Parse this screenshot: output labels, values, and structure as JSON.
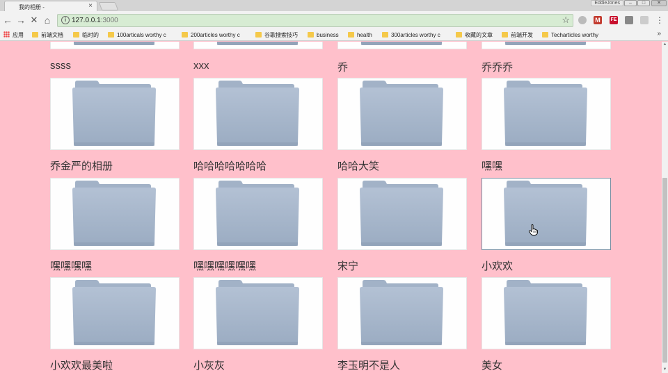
{
  "browser": {
    "tab_title": "我的相册 -",
    "tab_close": "×",
    "user_name": "EddieJones",
    "url_host": "127.0.0.1",
    "url_port": ":3000",
    "info_icon": "i",
    "star_icon": "☆"
  },
  "bookmarks": {
    "items": [
      {
        "label": "应用",
        "icon": "apps-icon"
      },
      {
        "label": "前端文档",
        "icon": "folder-icon"
      },
      {
        "label": "临时的",
        "icon": "folder-icon"
      },
      {
        "label": "100articals worthy c",
        "icon": "folder-icon"
      },
      {
        "label": "200articles worthy c",
        "icon": "folder-icon"
      },
      {
        "label": "谷歌搜索技巧",
        "icon": "folder-icon"
      },
      {
        "label": "business",
        "icon": "folder-icon"
      },
      {
        "label": "health",
        "icon": "folder-icon"
      },
      {
        "label": "300articles worthy c",
        "icon": "folder-icon"
      },
      {
        "label": "收藏的文章",
        "icon": "folder-icon"
      },
      {
        "label": "前端开发",
        "icon": "folder-icon"
      },
      {
        "label": "Techarticles worthy",
        "icon": "folder-icon"
      }
    ],
    "more": "»"
  },
  "albums": {
    "titles_row_top": [
      "ssss",
      "xxx",
      "乔",
      "乔乔乔"
    ],
    "titles_row_1": [
      "乔金严的相册",
      "哈哈哈哈哈哈哈",
      "哈哈大笑",
      "嘿嘿"
    ],
    "titles_row_2": [
      "嘿嘿嘿嘿",
      "嘿嘿嘿嘿嘿嘿",
      "宋宁",
      "小欢欢"
    ],
    "titles_row_3": [
      "小欢欢最美啦",
      "小灰灰",
      "李玉明不是人",
      "美女"
    ]
  },
  "colors": {
    "page_background": "#ffc0cb",
    "omnibox_background": "#d7ecd3",
    "folder_body": "#a9b9ce",
    "folder_tab": "#9fb0c6"
  }
}
